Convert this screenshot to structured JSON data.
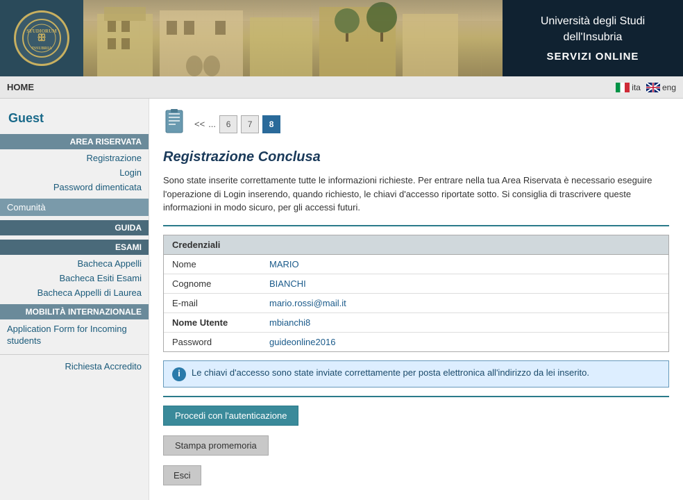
{
  "header": {
    "university_name": "Università degli Studi dell'Insubria",
    "servizi": "SERVIZI ONLINE",
    "logo_symbol": "ꕥ"
  },
  "navbar": {
    "home_label": "HOME",
    "lang_ita": "ita",
    "lang_eng": "eng"
  },
  "sidebar": {
    "user_label": "Guest",
    "section_area_riservata": "AREA RISERVATA",
    "item_registrazione": "Registrazione",
    "item_login": "Login",
    "item_password": "Password dimenticata",
    "comunita_label": "Comunità",
    "section_guida": "GUIDA",
    "section_esami": "ESAMI",
    "item_bacheca_appelli": "Bacheca Appelli",
    "item_bacheca_esiti": "Bacheca Esiti Esami",
    "item_bacheca_laurea": "Bacheca Appelli di Laurea",
    "section_mobilita": "MOBILITÀ INTERNAZIONALE",
    "item_application_form": "Application Form for Incoming students",
    "item_richiesta": "Richiesta Accredito"
  },
  "wizard": {
    "nav_prev": "<<",
    "nav_ellipsis": "...",
    "step_6": "6",
    "step_7": "7",
    "step_8": "8"
  },
  "content": {
    "page_title": "Registrazione Conclusa",
    "description": "Sono state inserite correttamente tutte le informazioni richieste. Per entrare nella tua Area Riservata è necessario eseguire l'operazione di Login inserendo, quando richiesto, le chiavi d'accesso riportate sotto. Si consiglia di trascrivere queste informazioni in modo sicuro, per gli accessi futuri.",
    "credentials_header": "Credenziali",
    "fields": {
      "nome_label": "Nome",
      "nome_value": "MARIO",
      "cognome_label": "Cognome",
      "cognome_value": "BIANCHI",
      "email_label": "E-mail",
      "email_value": "mario.rossi@mail.it",
      "nome_utente_label": "Nome Utente",
      "nome_utente_value": "mbianchi8",
      "password_label": "Password",
      "password_value": "guideonline2016"
    },
    "info_text": "Le chiavi d'accesso sono state inviate correttamente per posta elettronica all'indirizzo da lei inserito.",
    "btn_procedi": "Procedi con l'autenticazione",
    "btn_stampa": "Stampa promemoria",
    "btn_esci": "Esci"
  }
}
